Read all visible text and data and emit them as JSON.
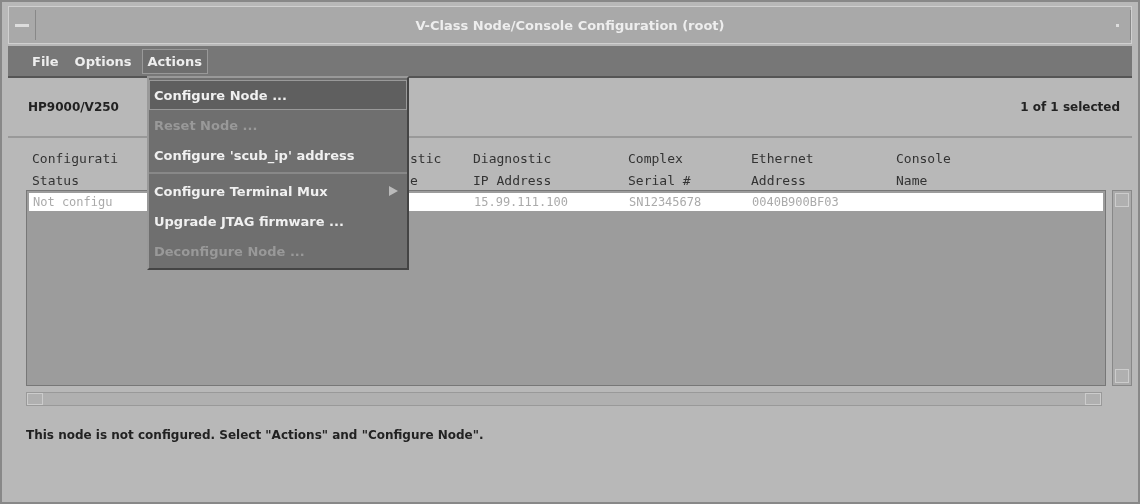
{
  "window": {
    "title": "V-Class Node/Console Configuration (root)"
  },
  "menubar": [
    {
      "label": "File",
      "selected": false
    },
    {
      "label": "Options",
      "selected": false
    },
    {
      "label": "Actions",
      "selected": true
    }
  ],
  "menu": [
    {
      "label": "Configure Node ...",
      "selected": true,
      "disabled": false,
      "submenu": false
    },
    {
      "label": "Reset Node ...",
      "selected": false,
      "disabled": true,
      "submenu": false
    },
    {
      "label": "Configure 'scub_ip' address",
      "selected": false,
      "disabled": false,
      "submenu": false
    },
    {
      "label": "Configure Terminal Mux",
      "selected": false,
      "disabled": false,
      "submenu": true
    },
    {
      "label": "Upgrade JTAG firmware ...",
      "selected": false,
      "disabled": false,
      "submenu": false
    },
    {
      "label": "Deconfigure Node ...",
      "selected": false,
      "disabled": true,
      "submenu": false
    }
  ],
  "info": {
    "system": "HP9000/V250",
    "selection": "1 of 1 selected"
  },
  "table": {
    "columns": [
      {
        "heading": "Configurati\nStatus"
      },
      {
        "heading": "stic\ne"
      },
      {
        "heading": "Diagnostic\nIP Address"
      },
      {
        "heading": "Complex\nSerial #"
      },
      {
        "heading": "Ethernet\nAddress"
      },
      {
        "heading": "Console\nName"
      }
    ],
    "rows": [
      {
        "selected": true,
        "cells": [
          "Not configu",
          "",
          "15.99.111.100",
          "SN12345678",
          "0040B900BF03",
          ""
        ]
      }
    ]
  },
  "status_message": "This node is not configured. Select \"Actions\" and \"Configure Node\"."
}
